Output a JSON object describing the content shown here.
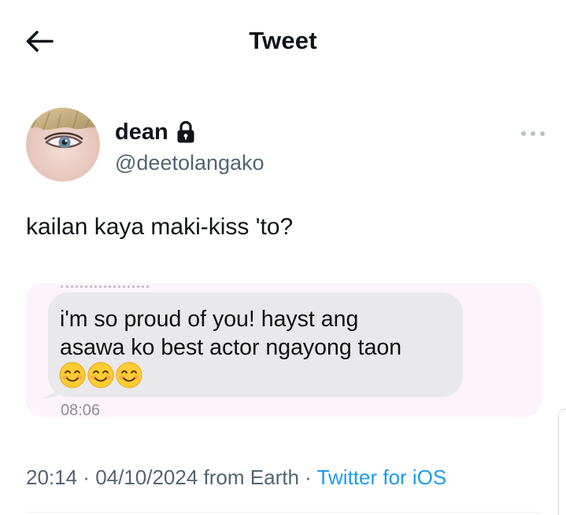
{
  "header": {
    "title": "Tweet",
    "back_icon": "arrow-left-icon"
  },
  "author": {
    "display_name": "dean",
    "handle": "@deetolangako",
    "protected_icon": "lock-icon",
    "more_icon": "more-dots-icon"
  },
  "tweet": {
    "text": "kailan kaya maki-kiss 'to?"
  },
  "media": {
    "message_lines": [
      "i'm so proud of you! hayst ang",
      "asawa ko best actor ngayong taon"
    ],
    "emoji": [
      "smiling-face-icon",
      "smiling-face-icon",
      "smiling-face-icon"
    ],
    "message_time": "08:06"
  },
  "meta": {
    "time": "20:14",
    "separator": " · ",
    "date": "04/10/2024",
    "location": " from Earth",
    "source": "Twitter for iOS"
  },
  "colors": {
    "text": "#0f1419",
    "secondary": "#536471",
    "link": "#1d9bf0",
    "bubble": "#e9e9eb",
    "media_bg": "#fdf3fb"
  }
}
